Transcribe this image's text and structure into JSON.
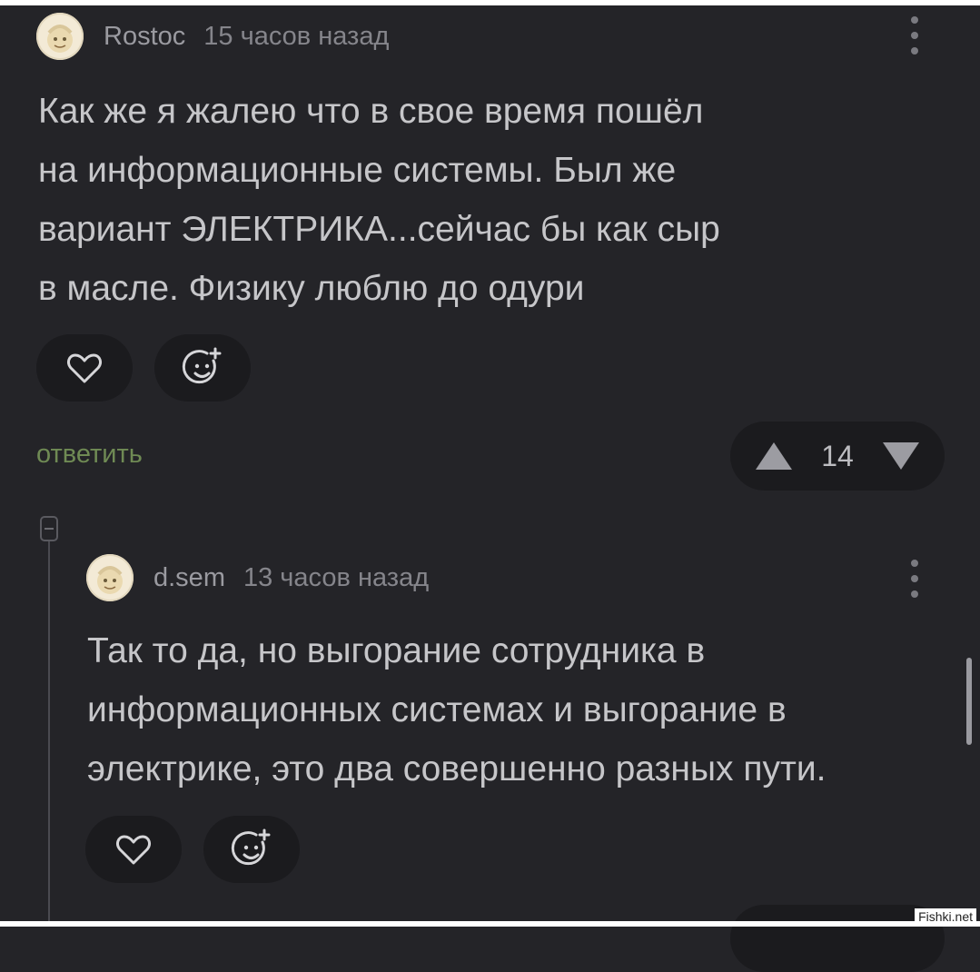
{
  "comments": [
    {
      "author": "Rostoc",
      "time": "15 часов назад",
      "lines": [
        "Как же я жалею что в свое время пошёл",
        "на информационные системы. Был же",
        "вариант ЭЛЕКТРИКА...сейчас бы как сыр",
        "в масле. Физику люблю до одури"
      ],
      "reply_label": "ответить",
      "rating": "14",
      "icons": {
        "like": "heart-icon",
        "react": "add-emoji-icon",
        "more": "more-vertical-icon"
      }
    },
    {
      "author": "d.sem",
      "time": "13 часов назад",
      "lines": [
        "Так то да, но выгорание сотрудника в",
        "информационных системах и выгорание в",
        "электрике, это два совершенно разных пути."
      ],
      "icons": {
        "like": "heart-icon",
        "react": "add-emoji-icon",
        "more": "more-vertical-icon"
      }
    }
  ],
  "watermark": "Fishki.net",
  "colors": {
    "background": "#242428",
    "reply": "#6f8a54",
    "button": "#1b1b1e"
  }
}
